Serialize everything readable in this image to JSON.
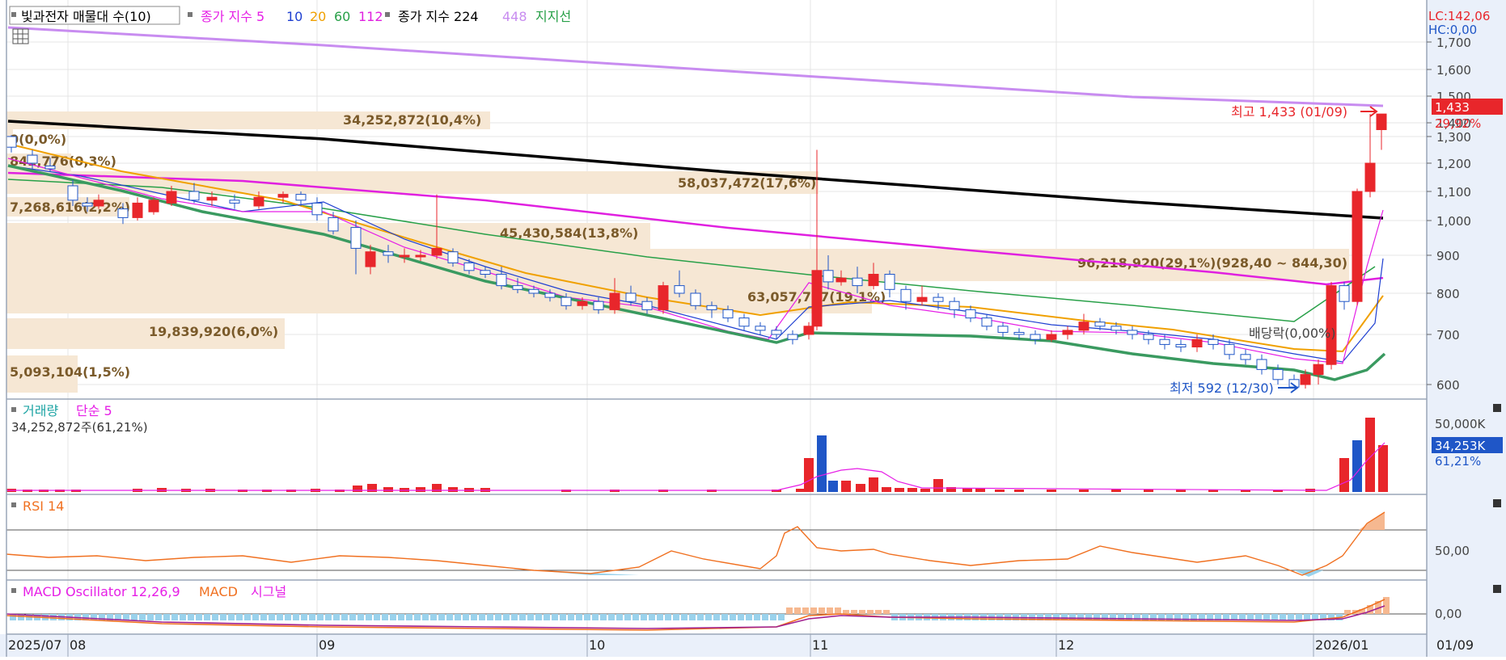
{
  "legend_main": {
    "title": "빛과전자 매물대 수(10)",
    "ma_label": "종가 지수",
    "ma_periods": [
      "5",
      "10",
      "20",
      "60",
      "112"
    ],
    "ma2_label": "종가 지수 224",
    "ma448": "448",
    "support": "지지선"
  },
  "right_panel": {
    "lc": "LC:142,06",
    "hc": "HC:0,00"
  },
  "price_axis": {
    "ticks": [
      "1,700",
      "1,600",
      "1,500",
      "1,400",
      "1,300",
      "1,200",
      "1,100",
      "1,000",
      "900",
      "800",
      "700",
      "600"
    ]
  },
  "current_price": {
    "value": "1,433",
    "change": "29,92%"
  },
  "high_label": "최고 1,433 (01/09)",
  "low_label": "최저 592 (12/30)",
  "dividend_label": "배당락(0,00%)",
  "volume_profile": [
    {
      "label": "34,252,872(10,4%)"
    },
    {
      "label": "0(0,0%)"
    },
    {
      "label": "842,776(0,3%)"
    },
    {
      "label": "58,037,472(17,6%)"
    },
    {
      "label": "7,268,616(2,2%)"
    },
    {
      "label": "45,430,584(13,8%)"
    },
    {
      "label": "96,218,920(29,1%)(928,40 ~ 844,30)"
    },
    {
      "label": "63,057,787(19,1%)"
    },
    {
      "label": "19,839,920(6,0%)"
    },
    {
      "label": "5,093,104(1,5%)"
    }
  ],
  "volume_panel": {
    "title": "거래량",
    "ma": "단순 5",
    "value_text": "34,252,872주(61,21%)",
    "axis_label": "50,000K",
    "current": "34,253K",
    "current_pct": "61,21%"
  },
  "rsi_panel": {
    "title": "RSI 14",
    "axis_label": "50,00"
  },
  "macd_panel": {
    "title": "MACD Oscillator 12,26,9",
    "macd": "MACD",
    "signal": "시그널",
    "axis_label": "0,00"
  },
  "time_axis": {
    "labels": [
      "2025/07",
      "08",
      "09",
      "10",
      "11",
      "12",
      "2026/01"
    ],
    "right_label": "01/09"
  },
  "colors": {
    "up": "#e8262b",
    "down": "#1f56c7",
    "ma5": "#e61ee6",
    "ma10": "#1e3fd1",
    "ma20": "#f0a000",
    "ma60": "#28a048",
    "ma112": "#e020e0",
    "ma224": "#000000",
    "ma448": "#c88cf0",
    "support": "#3a9a60"
  },
  "chart_data": {
    "type": "candlestick",
    "y_range": [
      580,
      1800
    ],
    "points": [
      {
        "x": "2025/07",
        "close": 1290
      },
      {
        "x": "08",
        "close": 1060
      },
      {
        "x": "09",
        "close": 930
      },
      {
        "x": "10",
        "close": 790
      },
      {
        "x": "10 late",
        "close": 710
      },
      {
        "x": "11",
        "close": 850
      },
      {
        "x": "11 mid",
        "close": 800
      },
      {
        "x": "12",
        "close": 700
      },
      {
        "x": "12/30",
        "close": 592
      },
      {
        "x": "01/09",
        "close": 1433
      }
    ]
  }
}
